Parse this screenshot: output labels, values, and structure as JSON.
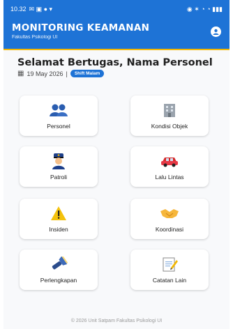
{
  "status": {
    "time": "10.32",
    "right": "⁙ ▢ ▤ ▤"
  },
  "app": {
    "title": "MONITORING KEAMANAN",
    "subtitle": "Fakultas Psikologi UI"
  },
  "greeting": {
    "title": "Selamat Bertugas, Nama Personel",
    "date": "19 May 2026",
    "separator": "|",
    "shift": "Shift Malam"
  },
  "menu": [
    {
      "label": "Personel",
      "icon": "people-icon"
    },
    {
      "label": "Kondisi Objek",
      "icon": "building-icon"
    },
    {
      "label": "Patroli",
      "icon": "police-officer-icon"
    },
    {
      "label": "Lalu Lintas",
      "icon": "car-icon"
    },
    {
      "label": "Insiden",
      "icon": "warning-icon"
    },
    {
      "label": "Koordinasi",
      "icon": "handshake-icon"
    },
    {
      "label": "Perlengkapan",
      "icon": "flashlight-icon"
    },
    {
      "label": "Catatan Lain",
      "icon": "memo-icon"
    }
  ],
  "footer": "© 2026 Unit Satpam Fakultas Psikologi UI",
  "colors": {
    "primary": "#1e73d6",
    "accent": "#f2b705",
    "background": "#f8f9fb"
  }
}
